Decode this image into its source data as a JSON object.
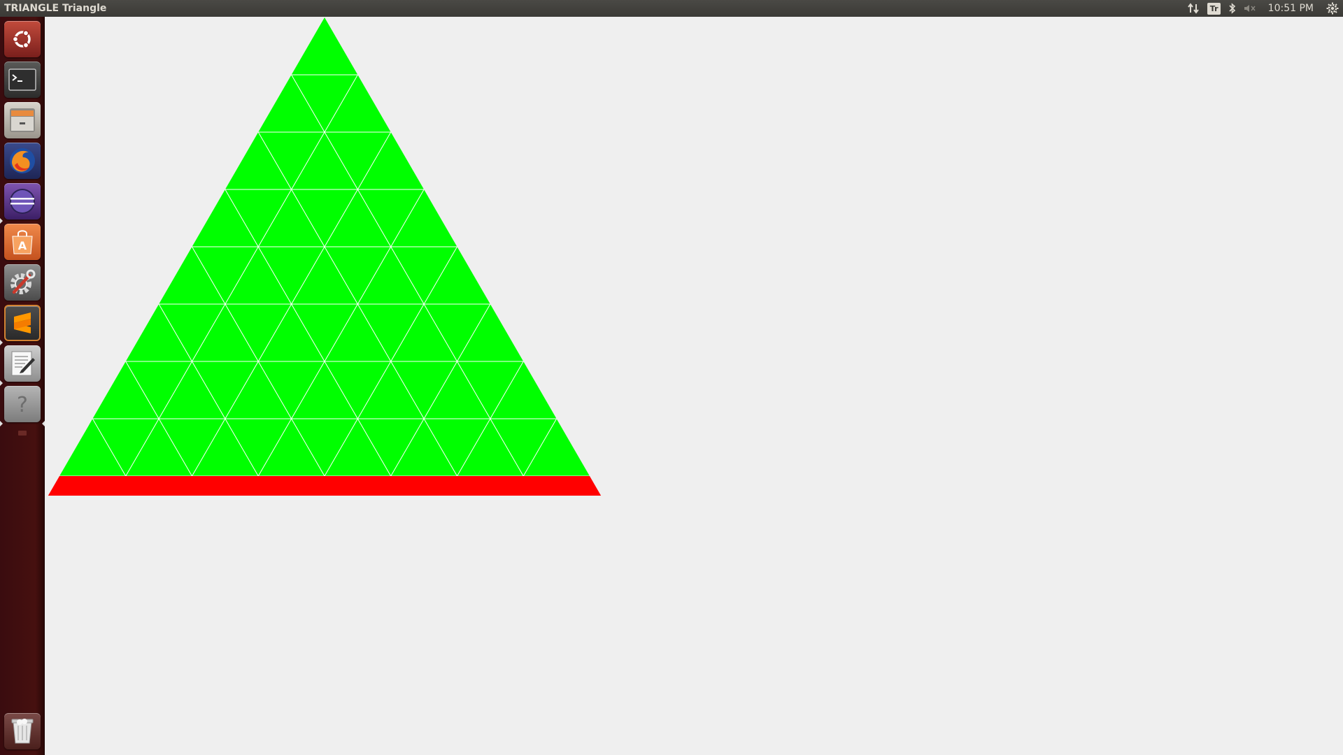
{
  "window": {
    "title": "TRIANGLE Triangle"
  },
  "panel": {
    "keyboard_layout": "Tr",
    "clock": "10:51 PM",
    "icons": [
      "network-icon",
      "keyboard-layout-indicator",
      "bluetooth-icon",
      "sound-muted-icon",
      "session-gear-icon"
    ]
  },
  "launcher": {
    "items": [
      {
        "name": "ubuntu-dash-button",
        "icon": "ubuntu-logo-icon"
      },
      {
        "name": "terminal-launcher",
        "icon": "terminal-icon"
      },
      {
        "name": "files-launcher",
        "icon": "file-cabinet-icon"
      },
      {
        "name": "firefox-launcher",
        "icon": "firefox-icon"
      },
      {
        "name": "eclipse-launcher",
        "icon": "eclipse-icon"
      },
      {
        "name": "software-center-launcher",
        "icon": "shopping-bag-icon"
      },
      {
        "name": "system-settings-launcher",
        "icon": "settings-gear-wrench-icon"
      },
      {
        "name": "sublime-text-launcher",
        "icon": "sublime-text-icon"
      },
      {
        "name": "text-editor-launcher",
        "icon": "text-editor-icon"
      },
      {
        "name": "unknown-app-launcher",
        "icon": "question-mark-icon"
      },
      {
        "name": "trash-launcher",
        "icon": "trash-icon"
      }
    ]
  },
  "triangle": {
    "subdivisions": 8,
    "fill_color": "#00ff00",
    "grid_line_color": "#ffffff",
    "base_bar_color": "#ff0000"
  },
  "colors": {
    "desktop_background": "#efefef",
    "panel_background": "#3b3a36",
    "launcher_background": "#46100f"
  }
}
